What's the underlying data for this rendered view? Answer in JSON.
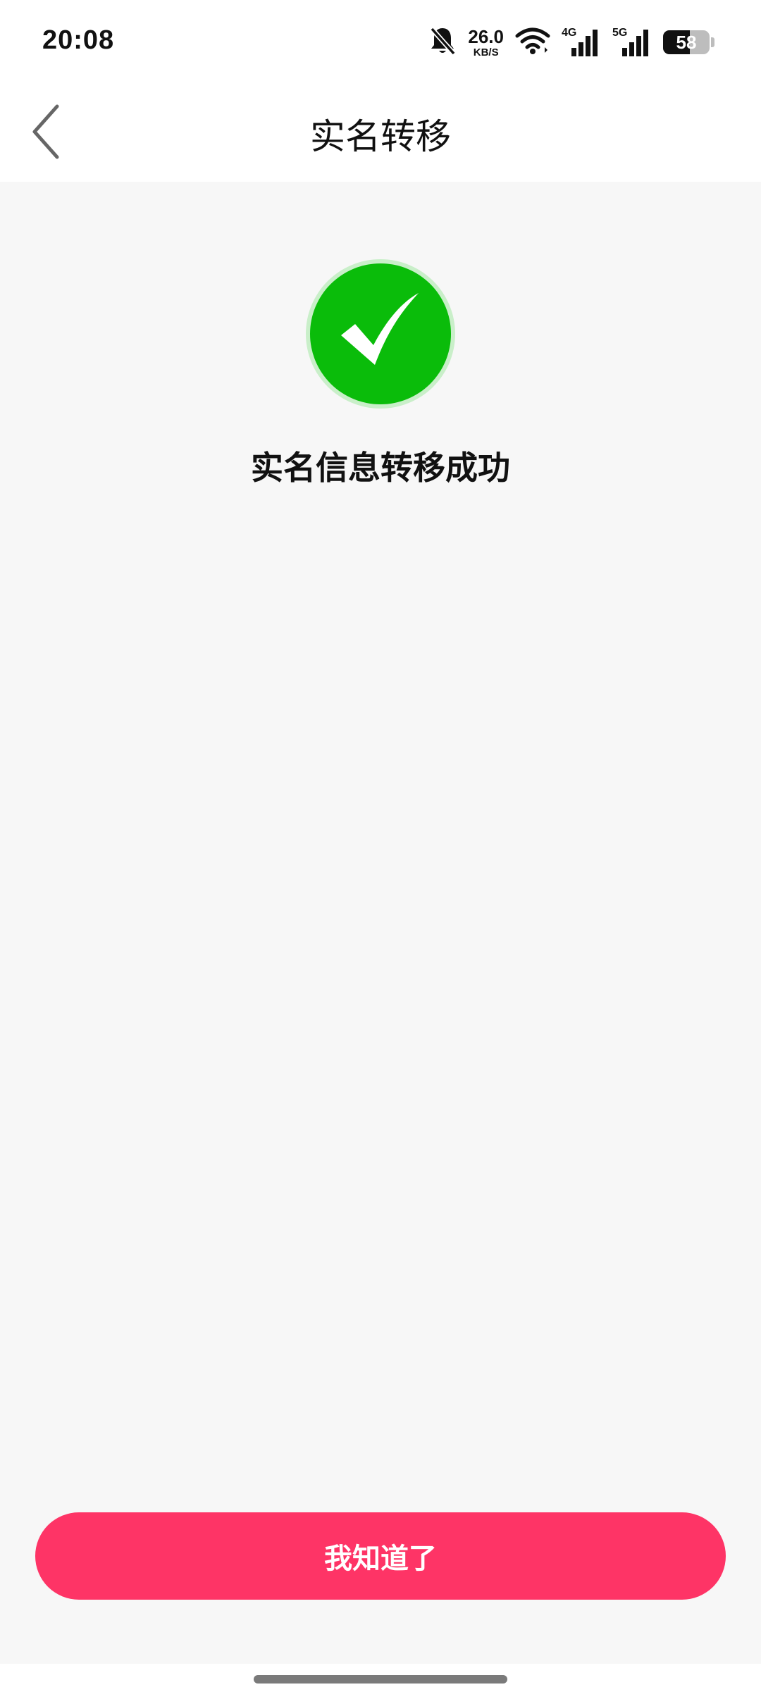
{
  "status_bar": {
    "time": "20:08",
    "net_speed_value": "26.0",
    "net_speed_unit": "KB/S",
    "signal_1_label": "4G",
    "signal_2_label": "5G",
    "battery_level": "58",
    "icons": [
      "bell-off-icon",
      "wifi-icon",
      "signal-icon",
      "battery-icon"
    ]
  },
  "nav": {
    "title": "实名转移",
    "back_icon": "chevron-left-icon"
  },
  "content": {
    "success_icon": "check-circle-icon",
    "message": "实名信息转移成功"
  },
  "actions": {
    "confirm_label": "我知道了"
  },
  "colors": {
    "accent": "#fe3466",
    "success": "#0abc0a",
    "background": "#f7f7f7"
  }
}
